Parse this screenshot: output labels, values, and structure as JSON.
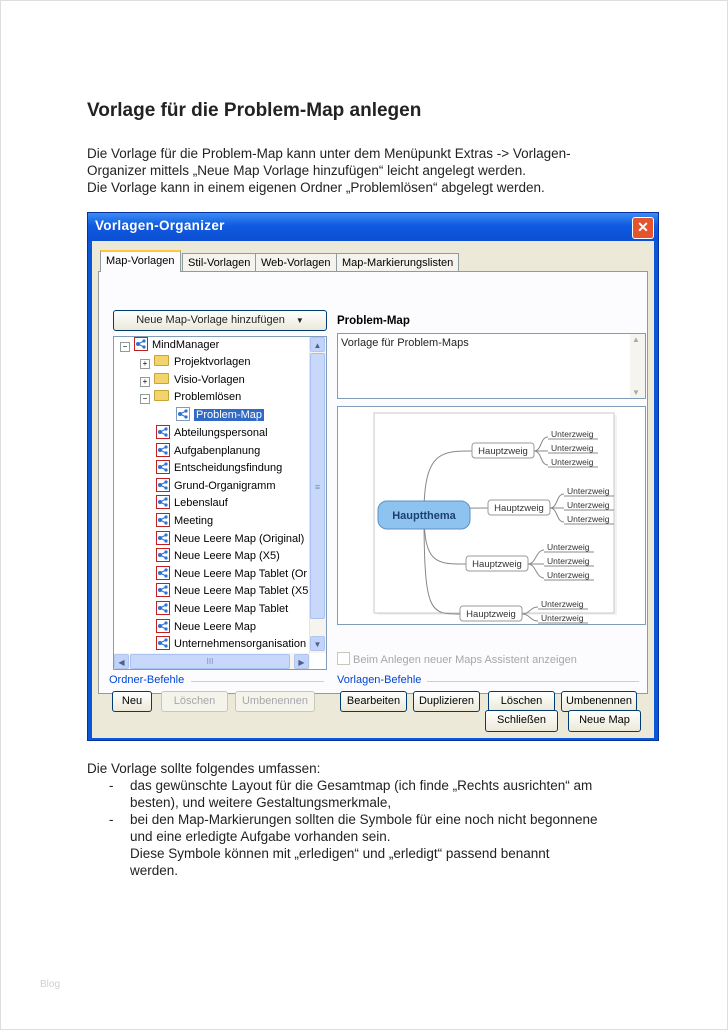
{
  "heading": "Vorlage für die Problem-Map anlegen",
  "intro": [
    "Die Vorlage für die Problem-Map kann unter dem Menüpunkt Extras -> Vorlagen-",
    "Organizer mittels „Neue Map Vorlage hinzufügen“ leicht angelegt werden.",
    "Die Vorlage kann in einem eigenen Ordner „Problemlösen“ abgelegt werden."
  ],
  "dialog": {
    "title": "Vorlagen-Organizer",
    "close_symbol": "✕",
    "tabs": [
      "Map-Vorlagen",
      "Stil-Vorlagen",
      "Web-Vorlagen",
      "Map-Markierungslisten"
    ],
    "add_button": "Neue Map-Vorlage hinzufügen",
    "dropdown_arrow": "▼",
    "tree": {
      "root": "MindManager",
      "folders": [
        "Projektvorlagen",
        "Visio-Vorlagen",
        "Problemlösen"
      ],
      "selected": "Problem-Map",
      "items": [
        "Abteilungspersonal",
        "Aufgabenplanung",
        "Entscheidungsfindung",
        "Grund-Organigramm",
        "Lebenslauf",
        "Meeting",
        "Neue Leere Map (Original)",
        "Neue Leere Map (X5)",
        "Neue Leere Map Tablet (Or",
        "Neue Leere Map Tablet (X5",
        "Neue Leere Map Tablet",
        "Neue Leere Map",
        "Unternehmensorganisation"
      ],
      "scroll_up": "▲",
      "scroll_down": "▼",
      "scroll_left": "◀",
      "scroll_right": "▶",
      "hthumb_grip": "III",
      "vthumb_grip": "≡"
    },
    "preview_title": "Problem-Map",
    "description": "Vorlage für Problem-Maps",
    "map_preview": {
      "central": "Hauptthema",
      "branches": [
        {
          "label": "Hauptzweig",
          "subs": [
            "Unterzweig",
            "Unterzweig",
            "Unterzweig"
          ]
        },
        {
          "label": "Hauptzweig",
          "subs": [
            "Unterzweig",
            "Unterzweig",
            "Unterzweig"
          ]
        },
        {
          "label": "Hauptzweig",
          "subs": [
            "Unterzweig",
            "Unterzweig",
            "Unterzweig"
          ]
        },
        {
          "label": "Hauptzweig",
          "subs": [
            "Unterzweig",
            "Unterzweig"
          ]
        }
      ]
    },
    "assistant_checkbox": "Beim Anlegen neuer Maps Assistent anzeigen",
    "folder_commands_label": "Ordner-Befehle",
    "folder_buttons": [
      "Neu",
      "Löschen",
      "Umbenennen"
    ],
    "template_commands_label": "Vorlagen-Befehle",
    "template_buttons": [
      "Bearbeiten",
      "Duplizieren",
      "Löschen",
      "Umbenennen"
    ],
    "close_button": "Schließen",
    "new_map_button": "Neue Map"
  },
  "after_intro": "Die Vorlage sollte folgendes umfassen:",
  "bullets": [
    {
      "dash": "-",
      "lines": [
        "das gewünschte Layout für die Gesamtmap (ich finde „Rechts ausrichten“ am",
        "besten), und weitere Gestaltungsmerkmale,"
      ]
    },
    {
      "dash": "-",
      "lines": [
        "bei den Map-Markierungen sollten die Symbole für eine noch nicht begonnene",
        "und eine erledigte Aufgabe vorhanden sein.",
        "Diese Symbole können mit „erledigen“ und „erledigt“ passend benannt",
        "werden."
      ]
    }
  ],
  "watermark": "Blog",
  "colors": {
    "titlebar": "#0f5ae0",
    "selection": "#316ac5",
    "central_node": "#8ec2ef"
  }
}
